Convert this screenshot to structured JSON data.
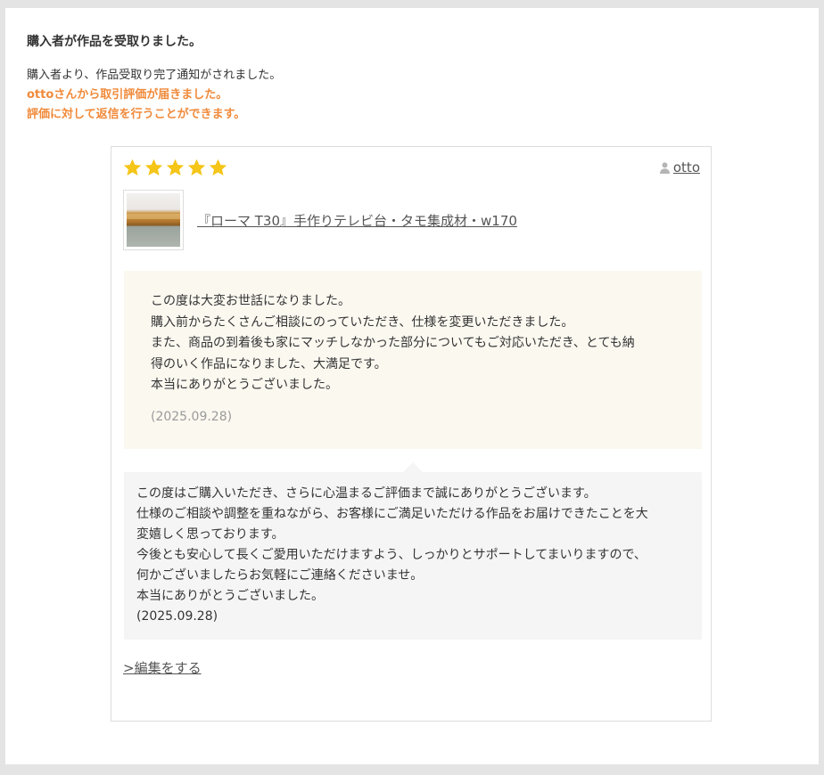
{
  "notice": {
    "title": "購入者が作品を受取りました。",
    "line1": "購入者より、作品受取り完了通知がされました。",
    "line2": "ottoさんから取引評価が届きました。",
    "line3": "評価に対して返信を行うことができます。"
  },
  "review": {
    "rating": 5,
    "max_rating": 5,
    "star_color": "#f5c518",
    "reviewer_icon": "person-icon",
    "reviewer_name": "otto",
    "product_title": "『ローマ T30』手作りテレビ台・タモ集成材・w170",
    "comment_lines": [
      "この度は大変お世話になりました。",
      "購入前からたくさんご相談にのっていただき、仕様を変更いただきました。",
      "また、商品の到着後も家にマッチしなかった部分についてもご対応いただき、とても納",
      "得のいく作品になりました、大満足です。",
      "本当にありがとうございました。"
    ],
    "date": "(2025.09.28)"
  },
  "reply": {
    "lines": [
      "この度はご購入いただき、さらに心温まるご評価まで誠にありがとうございます。",
      "仕様のご相談や調整を重ねながら、お客様にご満足いただける作品をお届けできたことを大",
      "変嬉しく思っております。",
      "今後とも安心して長くご愛用いただけますよう、しっかりとサポートしてまいりますので、",
      "何かございましたらお気軽にご連絡くださいませ。",
      "本当にありがとうございました。"
    ],
    "date": "(2025.09.28)"
  },
  "actions": {
    "edit_label": ">編集をする"
  }
}
